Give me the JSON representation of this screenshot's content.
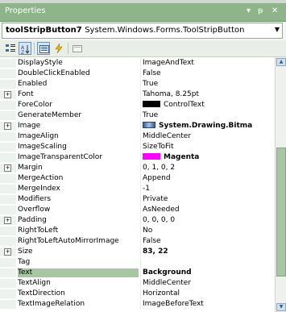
{
  "window": {
    "title": "Properties",
    "pin": "− 1",
    "close": "✕"
  },
  "object_selector": {
    "name": "toolStripButton7",
    "type": "System.Windows.Forms.ToolStripButton"
  },
  "toolbar": {
    "buttons": [
      "categorized-icon",
      "alphabetical-icon",
      "properties-icon",
      "events-icon",
      "property-pages-icon"
    ]
  },
  "properties": [
    {
      "name": "DisplayStyle",
      "value": "ImageAndText"
    },
    {
      "name": "DoubleClickEnabled",
      "value": "False"
    },
    {
      "name": "Enabled",
      "value": "True"
    },
    {
      "name": "Font",
      "value": "Tahoma, 8.25pt",
      "expand": "+"
    },
    {
      "name": "ForeColor",
      "value": "ControlText",
      "swatch": "#000000"
    },
    {
      "name": "GenerateMember",
      "value": "True"
    },
    {
      "name": "Image",
      "value": "System.Drawing.Bitma",
      "expand": "+",
      "image": true,
      "bold": true
    },
    {
      "name": "ImageAlign",
      "value": "MiddleCenter"
    },
    {
      "name": "ImageScaling",
      "value": "SizeToFit"
    },
    {
      "name": "ImageTransparentColor",
      "value": "Magenta",
      "swatch": "#ff00ff",
      "bold": true
    },
    {
      "name": "Margin",
      "value": "0, 1, 0, 2",
      "expand": "+"
    },
    {
      "name": "MergeAction",
      "value": "Append"
    },
    {
      "name": "MergeIndex",
      "value": "-1"
    },
    {
      "name": "Modifiers",
      "value": "Private"
    },
    {
      "name": "Overflow",
      "value": "AsNeeded"
    },
    {
      "name": "Padding",
      "value": "0, 0, 0, 0",
      "expand": "+"
    },
    {
      "name": "RightToLeft",
      "value": "No"
    },
    {
      "name": "RightToLeftAutoMirrorImage",
      "value": "False"
    },
    {
      "name": "Size",
      "value": "83, 22",
      "expand": "+",
      "bold": true
    },
    {
      "name": "Tag",
      "value": ""
    },
    {
      "name": "Text",
      "value": "Background",
      "bold": true,
      "selected": true
    },
    {
      "name": "TextAlign",
      "value": "MiddleCenter"
    },
    {
      "name": "TextDirection",
      "value": "Horizontal"
    },
    {
      "name": "TextImageRelation",
      "value": "ImageBeforeText"
    }
  ]
}
